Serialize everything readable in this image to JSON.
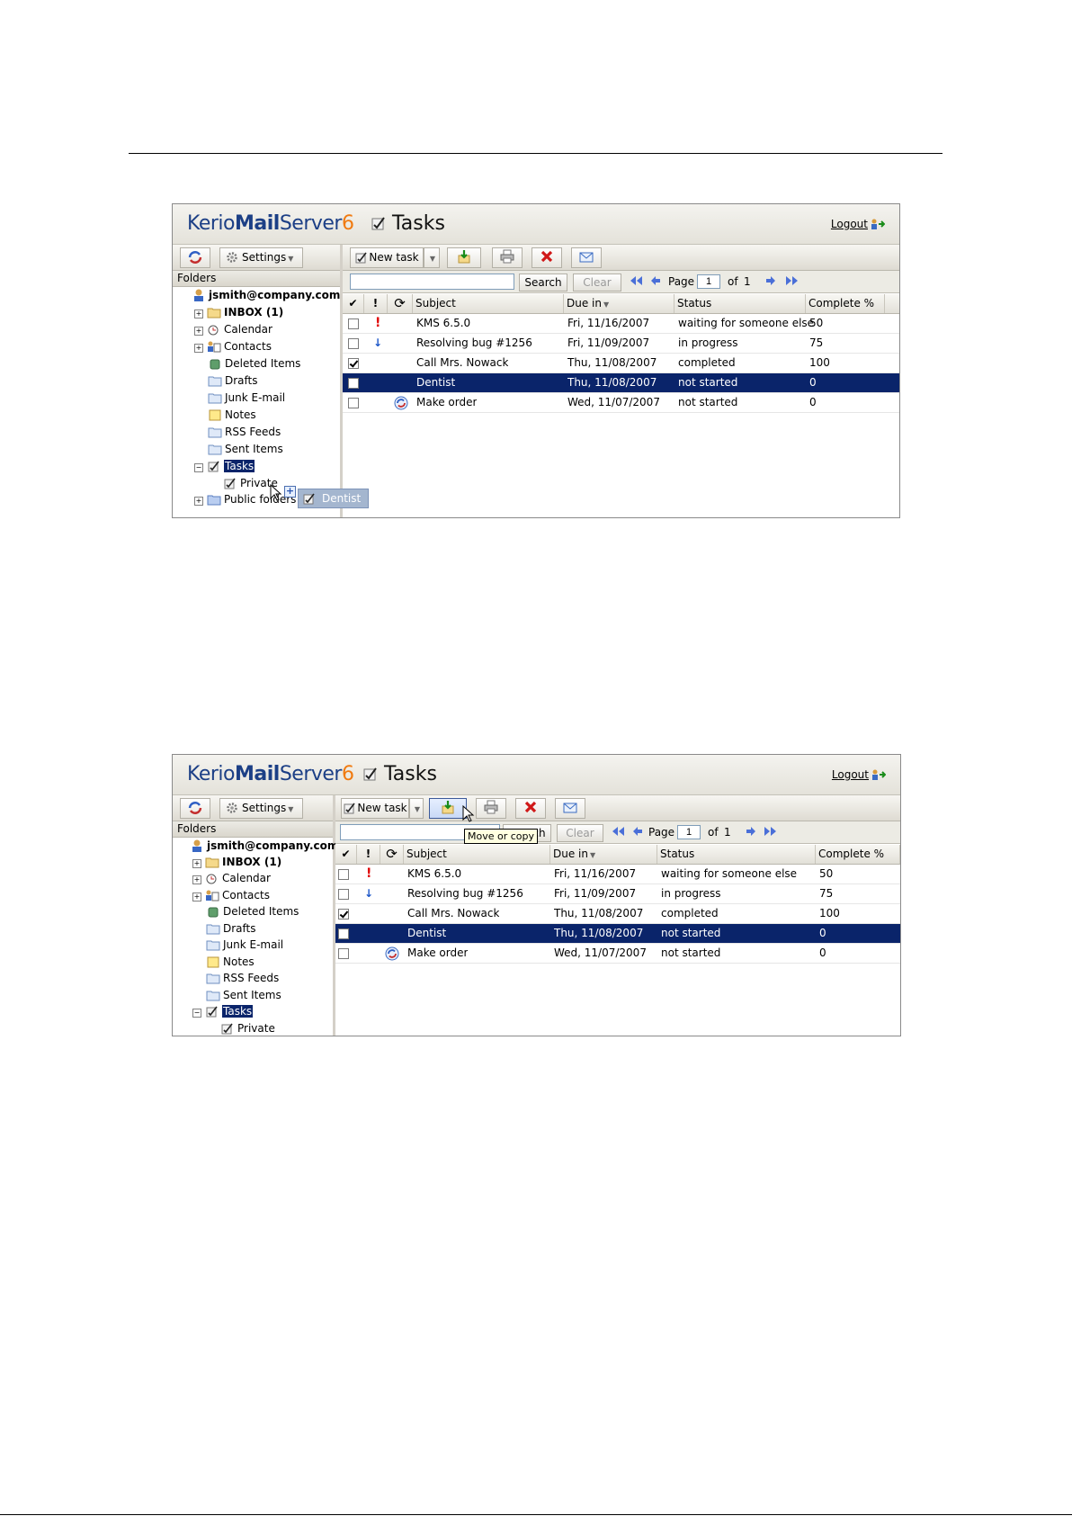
{
  "logo": {
    "part1": "Kerio",
    "part2": "Mail",
    "part3": "Server",
    "part4": "6"
  },
  "app_title": "Tasks",
  "logout_label": "Logout",
  "left_toolbar": {
    "settings_label": "Settings"
  },
  "folders_header": "Folders",
  "tree": {
    "account": "jsmith@company.com",
    "items": [
      {
        "label": "INBOX (1)"
      },
      {
        "label": "Calendar"
      },
      {
        "label": "Contacts"
      },
      {
        "label": "Deleted Items"
      },
      {
        "label": "Drafts"
      },
      {
        "label": "Junk E-mail"
      },
      {
        "label": "Notes"
      },
      {
        "label": "RSS Feeds"
      },
      {
        "label": "Sent Items"
      },
      {
        "label": "Tasks"
      },
      {
        "label": "Private"
      },
      {
        "label": "Public folders"
      }
    ]
  },
  "toolbar": {
    "new_task_label": "New task"
  },
  "searchbar": {
    "search_value": "",
    "search_label": "Search",
    "clear_label": "Clear",
    "page_label": "Page",
    "page_value": "1",
    "of_label": "of",
    "total_pages": "1"
  },
  "grid": {
    "columns": {
      "check": "✔",
      "priority": "!",
      "recurrence": "⟳",
      "subject": "Subject",
      "due": "Due in",
      "status": "Status",
      "complete": "Complete %"
    },
    "rows": [
      {
        "checked": false,
        "priority": "high",
        "recurring": false,
        "subject": "KMS 6.5.0",
        "due": "Fri, 11/16/2007",
        "status": "waiting for someone else",
        "complete": "50"
      },
      {
        "checked": false,
        "priority": "low",
        "recurring": false,
        "subject": "Resolving bug #1256",
        "due": "Fri, 11/09/2007",
        "status": "in progress",
        "complete": "75"
      },
      {
        "checked": true,
        "priority": "",
        "recurring": false,
        "subject": "Call Mrs. Nowack",
        "due": "Thu, 11/08/2007",
        "status": "completed",
        "complete": "100"
      },
      {
        "checked": false,
        "priority": "",
        "recurring": false,
        "subject": "Dentist",
        "due": "Thu, 11/08/2007",
        "status": "not started",
        "complete": "0",
        "selected": true
      },
      {
        "checked": false,
        "priority": "",
        "recurring": true,
        "subject": "Make order",
        "due": "Wed, 11/07/2007",
        "status": "not started",
        "complete": "0"
      }
    ]
  },
  "drag_ghost_label": "Dentist",
  "tooltip_label": "Move or copy"
}
